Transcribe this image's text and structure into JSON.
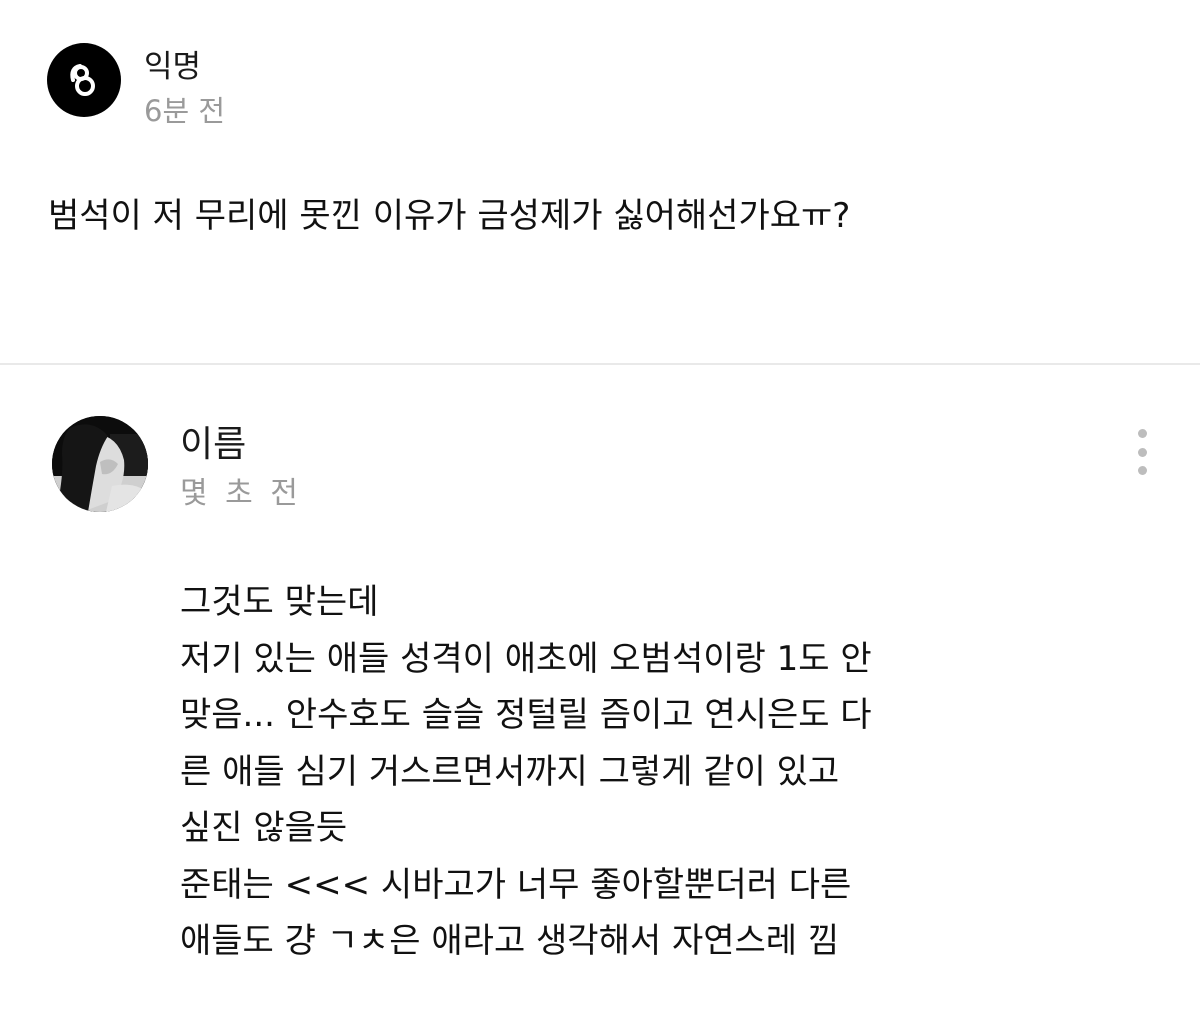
{
  "post": {
    "author": "익명",
    "time": "6분 전",
    "body": "범석이 저 무리에 못낀 이유가 금성제가 싫어해선가요ㅠ?",
    "avatar_icon": "logo-icon"
  },
  "comment": {
    "author": "이름",
    "time": "몇 초 전",
    "avatar_icon": "profile-photo",
    "more_icon": "more-vertical-icon",
    "lines": [
      "그것도 맞는데",
      "저기 있는 애들 성격이 애초에 오범석이랑 1도 안",
      "맞음... 안수호도 슬슬 정털릴 즘이고 연시은도 다",
      "른 애들 심기 거스르면서까지 그렇게 같이 있고",
      "싶진 않을듯",
      "준태는 <<< 시바고가 너무 좋아할뿐더러 다른",
      "애들도 걍 ㄱㅊ은 애라고 생각해서 자연스레 낌"
    ]
  },
  "colors": {
    "text": "#111111",
    "muted": "#9a9a9a",
    "divider": "#e9e9e9",
    "icon_gray": "#bdbdbd",
    "avatar_bg": "#000000"
  }
}
